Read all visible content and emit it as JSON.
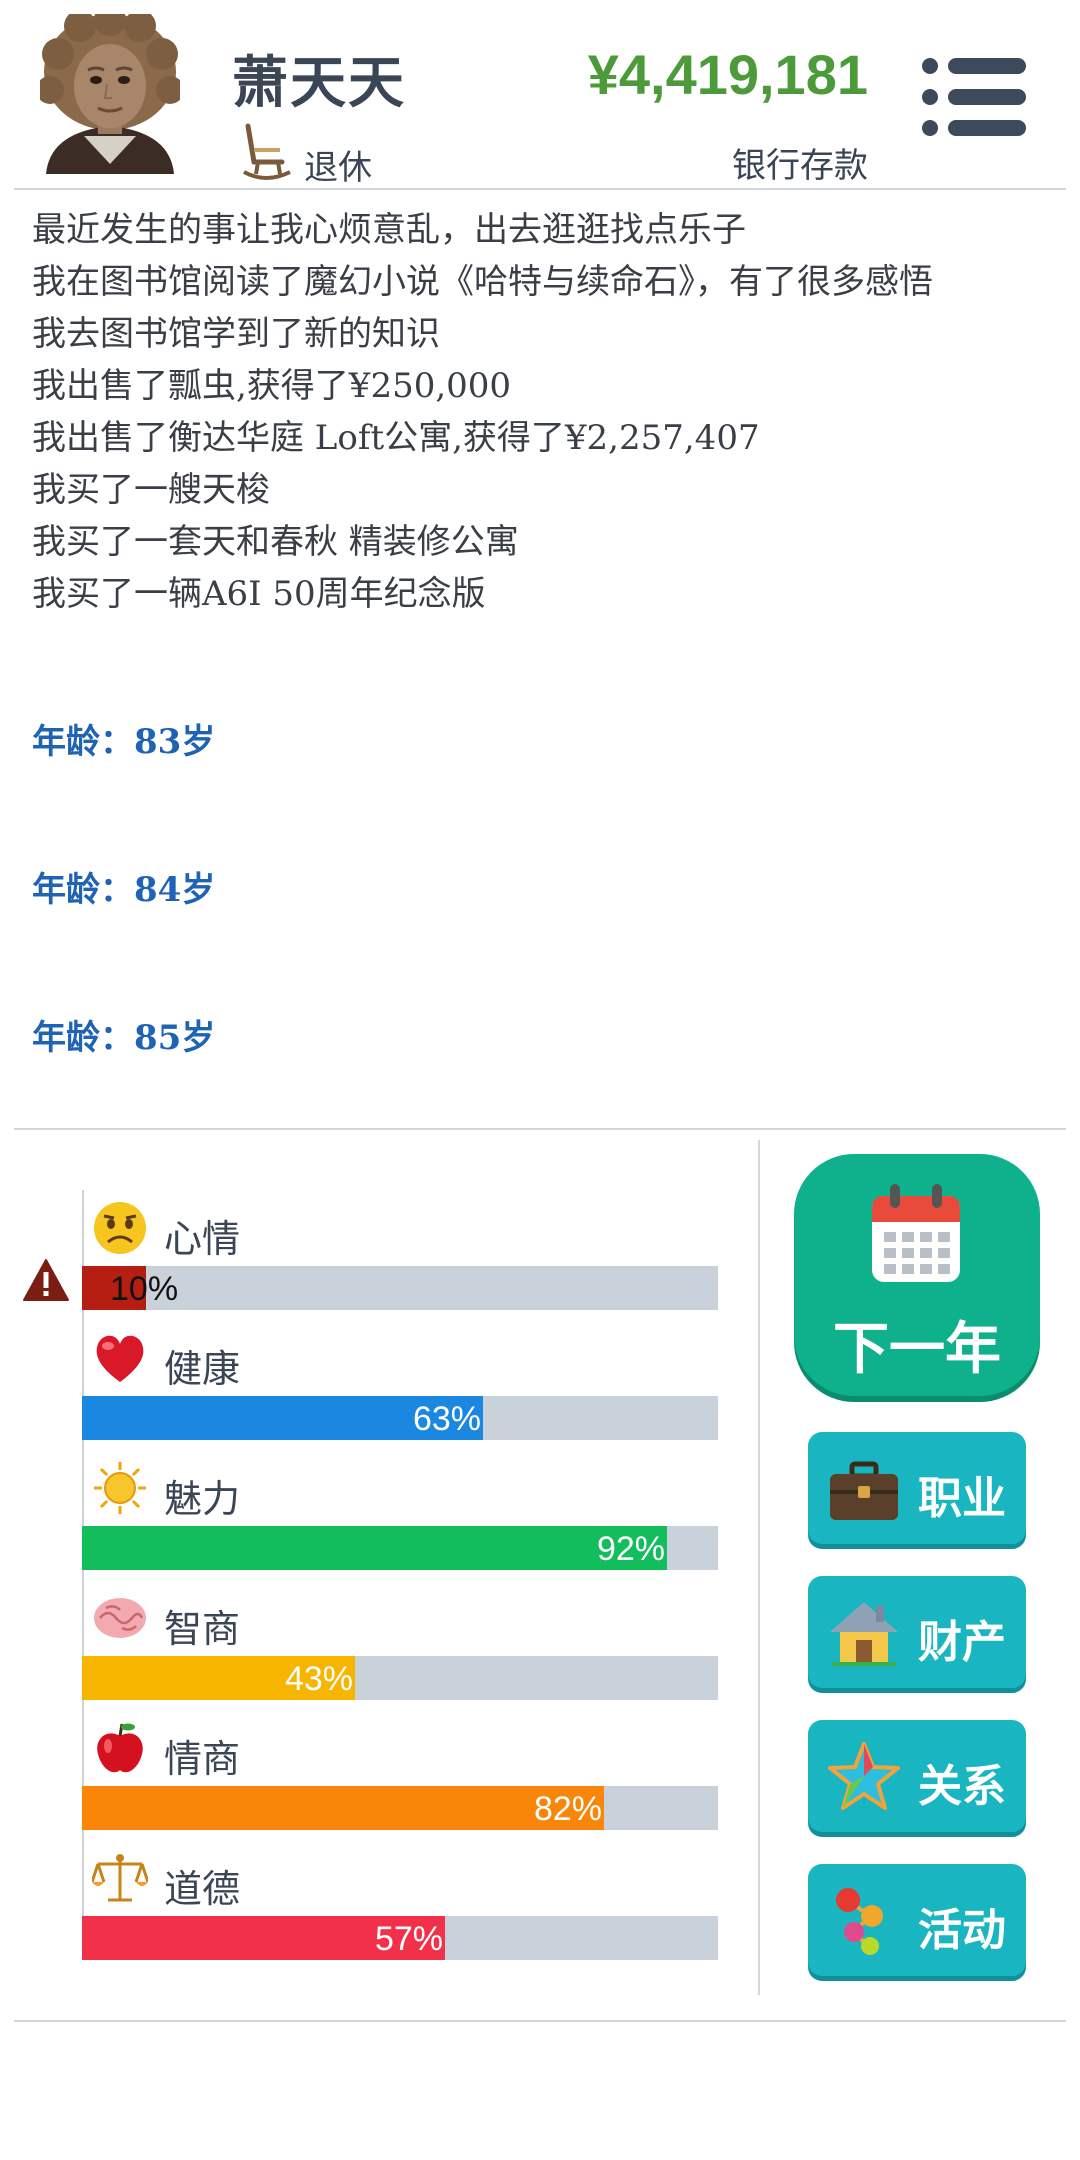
{
  "header": {
    "name": "萧天天",
    "status": "退休",
    "balance": "¥4,419,181",
    "balance_label": "银行存款"
  },
  "log": {
    "lines": [
      "最近发生的事让我心烦意乱，出去逛逛找点乐子",
      "我在图书馆阅读了魔幻小说《哈特与续命石》，有了很多感悟",
      "我去图书馆学到了新的知识",
      "我出售了瓢虫,获得了¥250,000",
      "我出售了衡达华庭 Loft公寓,获得了¥2,257,407",
      "我买了一艘天梭",
      "我买了一套天和春秋 精装修公寓",
      "我买了一辆A6I 50周年纪念版"
    ],
    "ages": [
      "年龄：83岁",
      "年龄：84岁",
      "年龄：85岁"
    ]
  },
  "stats": [
    {
      "label": "心情",
      "value": 10,
      "pct": "10%",
      "color": "#b51e10",
      "icon": "sad-face-icon",
      "warning": true
    },
    {
      "label": "健康",
      "value": 63,
      "pct": "63%",
      "color": "#1a88e0",
      "icon": "heart-icon"
    },
    {
      "label": "魅力",
      "value": 92,
      "pct": "92%",
      "color": "#12bd5c",
      "icon": "sun-icon"
    },
    {
      "label": "智商",
      "value": 43,
      "pct": "43%",
      "color": "#f7b500",
      "icon": "brain-icon"
    },
    {
      "label": "情商",
      "value": 82,
      "pct": "82%",
      "color": "#f98608",
      "icon": "apple-icon"
    },
    {
      "label": "道德",
      "value": 57,
      "pct": "57%",
      "color": "#f2304a",
      "icon": "scales-icon"
    }
  ],
  "actions": {
    "next_year": "下一年",
    "career": "职业",
    "property": "财产",
    "relations": "关系",
    "activities": "活动"
  }
}
